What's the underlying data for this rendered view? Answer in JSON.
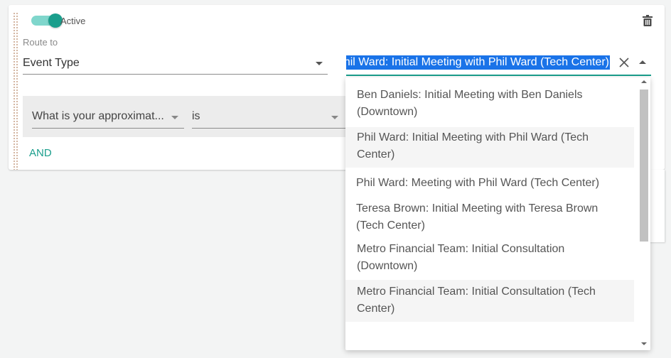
{
  "rule": {
    "toggle_label": "Active",
    "toggle_on": true,
    "route_label": "Route to",
    "route_select_value": "Event Type",
    "condition_question": "What is your approximat...",
    "condition_operator": "is",
    "and_label": "AND"
  },
  "combobox": {
    "selected_text": "Phil Ward: Initial Meeting with Phil Ward (Tech Center)"
  },
  "dropdown": {
    "options": [
      {
        "line1": "Ben Daniels: Initial Meeting with Ben Daniels",
        "line2": "(Downtown)"
      },
      {
        "line1": "Phil Ward: Initial Meeting with Phil Ward (Tech",
        "line2": "Center)"
      },
      {
        "line1": "Phil Ward: Meeting with Phil Ward (Tech Center)",
        "line2": ""
      },
      {
        "line1": "Teresa Brown: Initial Meeting with Teresa Brown",
        "line2": "(Tech Center)"
      },
      {
        "line1": "Metro Financial Team: Initial Consultation",
        "line2": "(Downtown)"
      },
      {
        "line1": "Metro Financial Team: Initial Consultation (Tech",
        "line2": "Center)"
      }
    ]
  },
  "colors": {
    "accent": "#1a9e8c",
    "selection": "#1a73e8"
  },
  "icons": [
    "trash-icon",
    "close-icon",
    "chevron-down-icon",
    "chevron-up-icon",
    "drag-handle-icon"
  ]
}
